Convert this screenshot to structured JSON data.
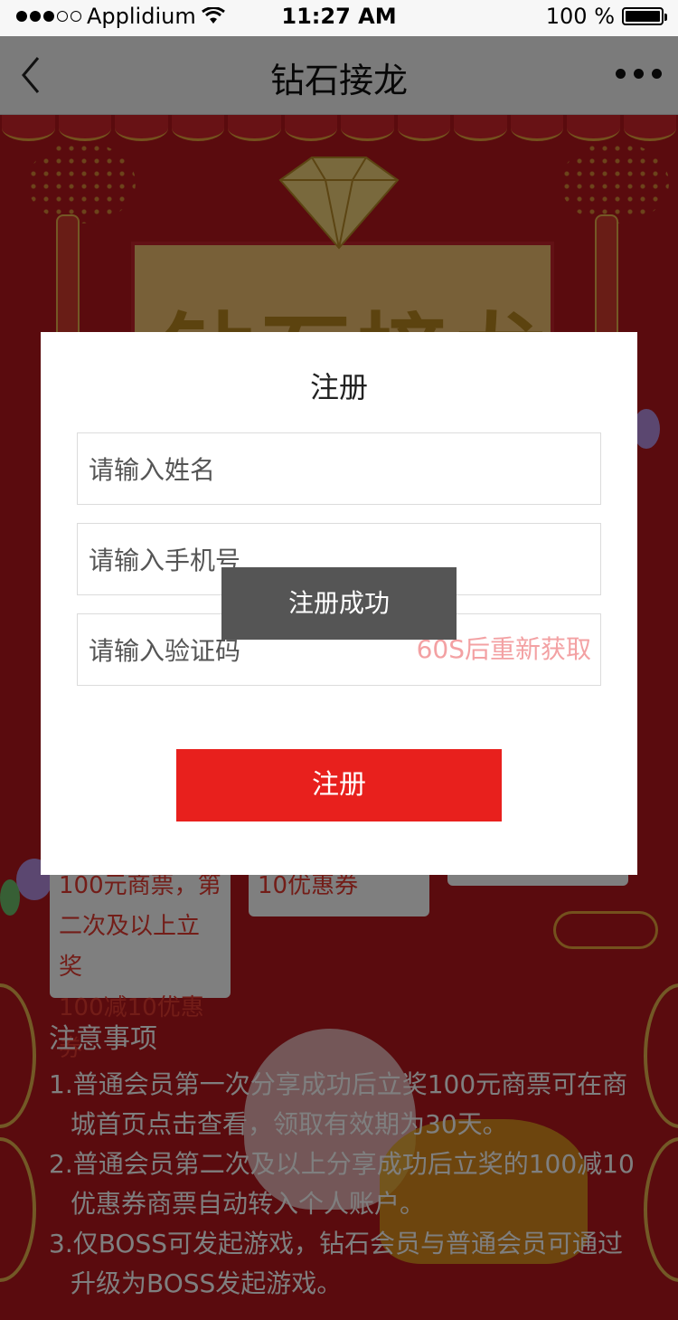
{
  "status_bar": {
    "carrier": "Applidium",
    "time": "11:27 AM",
    "battery": "100 %"
  },
  "nav": {
    "title": "钻石接龙"
  },
  "banner": {
    "headline": "钻石接龙"
  },
  "prize_cards": [
    {
      "lines": [
        "100元商票，第",
        "二次及以上立奖",
        "100减10优惠券"
      ]
    },
    {
      "lines": [
        "10优惠券"
      ]
    },
    {
      "lines": [
        ""
      ]
    }
  ],
  "notice": {
    "heading": "注意事项",
    "items": [
      "1.普通会员第一次分享成功后立奖100元商票可在商城首页点击查看，领取有效期为30天。",
      "2.普通会员第二次及以上分享成功后立奖的100减10优惠券商票自动转入个人账户。",
      "3.仅BOSS可发起游戏，钻石会员与普通会员可通过升级为BOSS发起游戏。"
    ]
  },
  "modal": {
    "title": "注册",
    "name_placeholder": "请输入姓名",
    "phone_placeholder": "请输入手机号",
    "code_placeholder": "请输入验证码",
    "resend_label": "60S后重新获取",
    "submit_label": "注册"
  },
  "toast": {
    "message": "注册成功"
  }
}
